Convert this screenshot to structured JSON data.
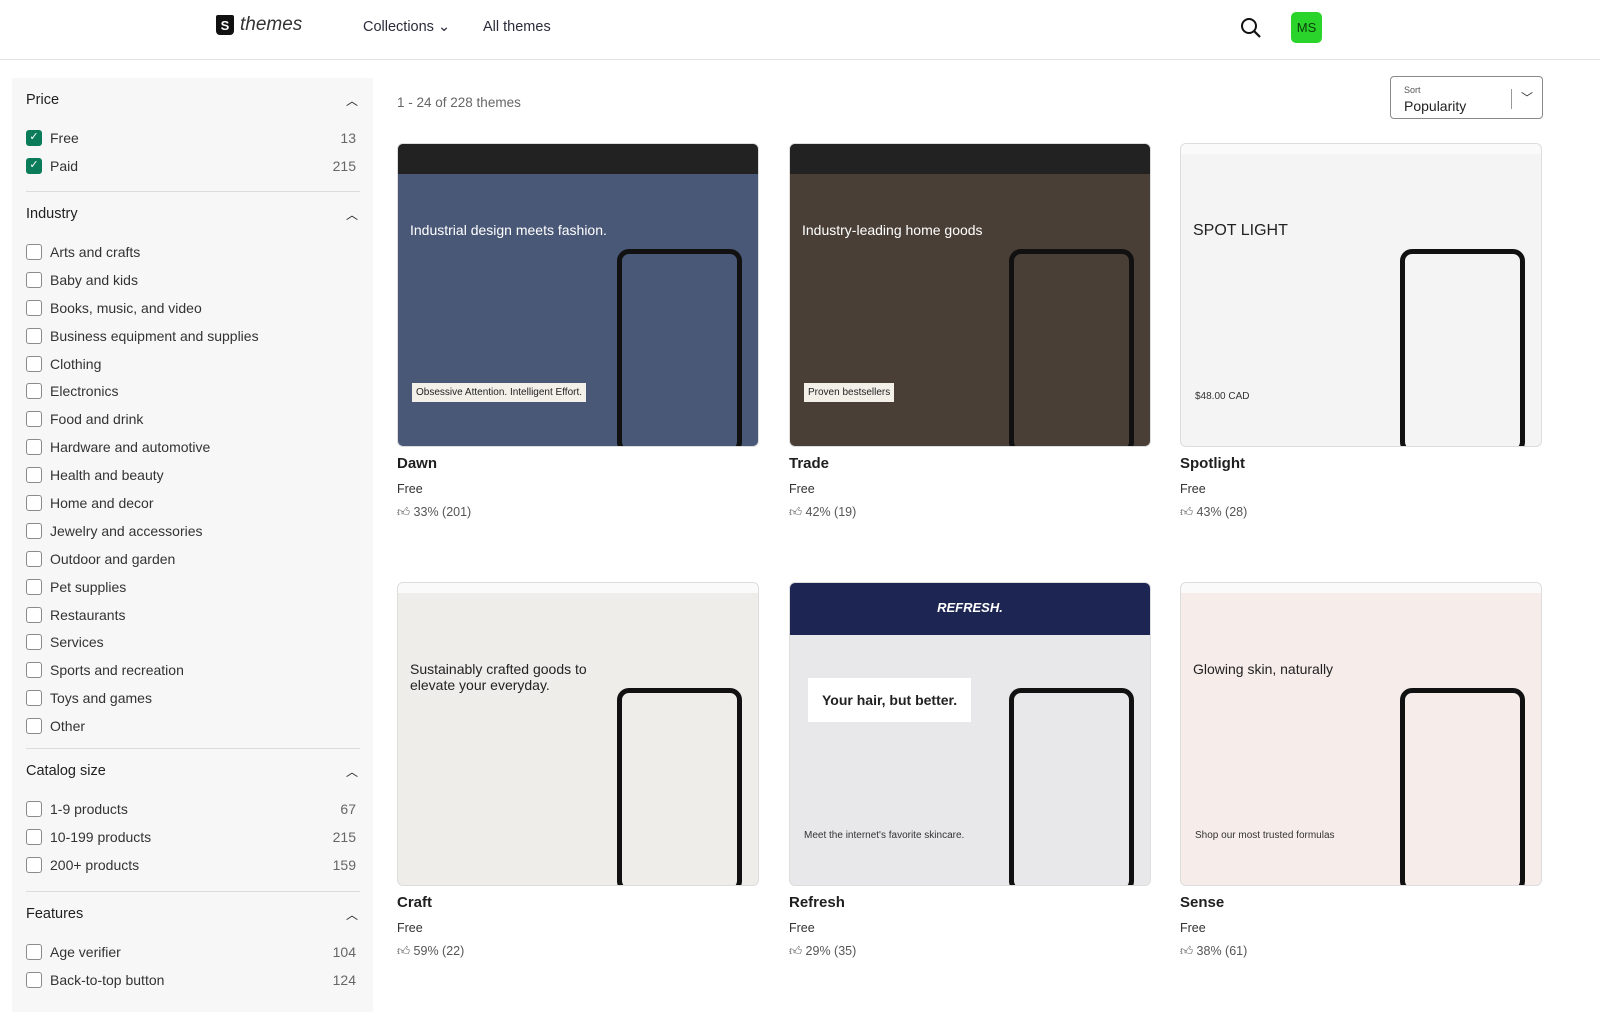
{
  "header": {
    "logo_text": "themes",
    "nav": [
      {
        "label": "Collections ⌄"
      },
      {
        "label": "All themes"
      }
    ],
    "avatar": "MS"
  },
  "results": {
    "count_text": "1 - 24 of 228 themes",
    "sort_label": "Sort",
    "sort_value": "Popularity"
  },
  "filters": {
    "price": {
      "title": "Price",
      "options": [
        {
          "label": "Free",
          "count": "13",
          "checked": true
        },
        {
          "label": "Paid",
          "count": "215",
          "checked": true
        }
      ]
    },
    "industry": {
      "title": "Industry",
      "options": [
        "Arts and crafts",
        "Baby and kids",
        "Books, music, and video",
        "Business equipment and supplies",
        "Clothing",
        "Electronics",
        "Food and drink",
        "Hardware and automotive",
        "Health and beauty",
        "Home and decor",
        "Jewelry and accessories",
        "Outdoor and garden",
        "Pet supplies",
        "Restaurants",
        "Services",
        "Sports and recreation",
        "Toys and games",
        "Other"
      ]
    },
    "catalog": {
      "title": "Catalog size",
      "options": [
        {
          "label": "1-9 products",
          "count": "67"
        },
        {
          "label": "10-199 products",
          "count": "215"
        },
        {
          "label": "200+ products",
          "count": "159"
        }
      ]
    },
    "features": {
      "title": "Features",
      "options": [
        {
          "label": "Age verifier",
          "count": "104"
        },
        {
          "label": "Back-to-top button",
          "count": "124"
        }
      ]
    }
  },
  "themes": [
    {
      "name": "Dawn",
      "price": "Free",
      "rating": "33% (201)",
      "bg": "#4a5878",
      "headline": "Industrial design meets fashion.",
      "sub": "Obsessive Attention. Intelligent Effort."
    },
    {
      "name": "Trade",
      "price": "Free",
      "rating": "42% (19)",
      "bg": "#4a3f36",
      "headline": "Industry-leading home goods",
      "sub": "Proven bestsellers"
    },
    {
      "name": "Spotlight",
      "price": "Free",
      "rating": "43% (28)",
      "bg": "#f4f4f4",
      "headline": "SPOT LIGHT",
      "sub": "$48.00 CAD"
    },
    {
      "name": "Craft",
      "price": "Free",
      "rating": "59% (22)",
      "bg": "#efedea",
      "headline": "Sustainably crafted goods to elevate your everyday.",
      "sub": ""
    },
    {
      "name": "Refresh",
      "price": "Free",
      "rating": "29% (35)",
      "bg": "#e8e8ea",
      "headline": "Your hair, but better.",
      "sub": "Meet the internet's favorite skincare.",
      "brand": "REFRESH."
    },
    {
      "name": "Sense",
      "price": "Free",
      "rating": "38% (61)",
      "bg": "#f6ecea",
      "headline": "Glowing skin, naturally",
      "sub": "Shop our most trusted formulas"
    }
  ]
}
